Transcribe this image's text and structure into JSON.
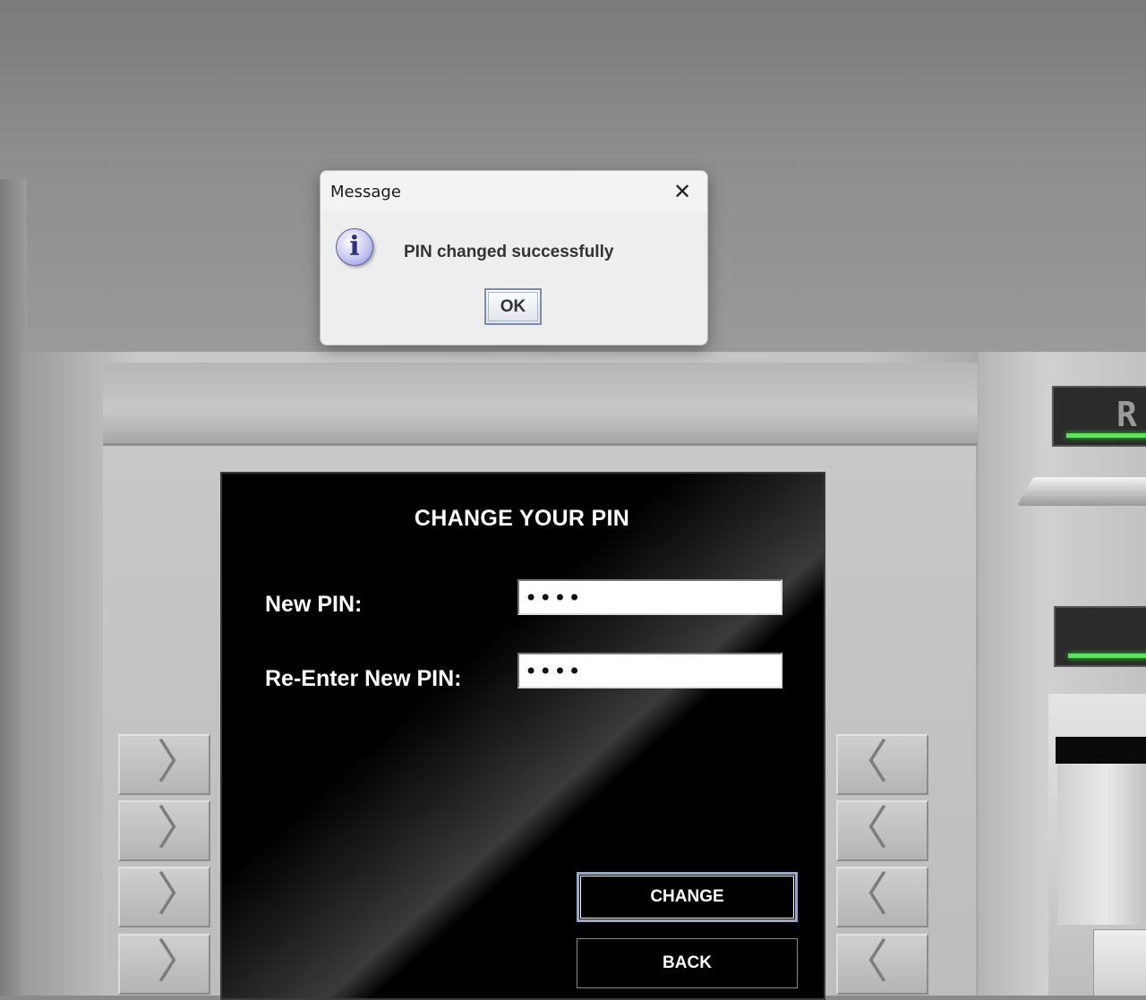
{
  "dialog": {
    "title": "Message",
    "close_glyph": "✕",
    "icon": "info-icon",
    "icon_glyph": "i",
    "message": "PIN changed successfully",
    "ok_label": "OK"
  },
  "screen": {
    "title": "CHANGE YOUR PIN",
    "new_pin_label": "New PIN:",
    "new_pin_value": "••••",
    "reenter_pin_label": "Re-Enter New PIN:",
    "reenter_pin_value": "••••",
    "change_label": "CHANGE",
    "back_label": "BACK"
  },
  "side_keys": {
    "left_glyph": "〉",
    "right_glyph": "〈"
  },
  "right_module": {
    "sign_text": "R"
  },
  "colors": {
    "screen_bg": "#000000",
    "led": "#5fe05f",
    "dialog_bg": "#eeeeee"
  }
}
